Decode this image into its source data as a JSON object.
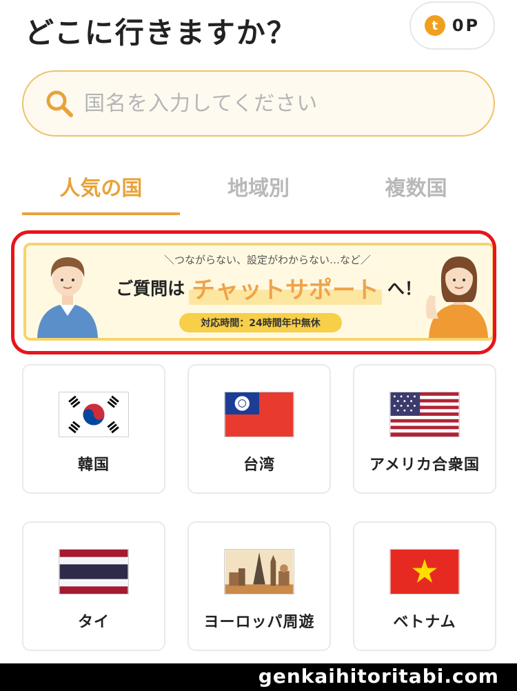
{
  "header": {
    "title": "どこに行きますか？",
    "points": "0P",
    "points_icon_letter": "t"
  },
  "search": {
    "placeholder": "国名を入力してください"
  },
  "tabs": [
    {
      "label": "人気の国",
      "active": true
    },
    {
      "label": "地域別",
      "active": false
    },
    {
      "label": "複数国",
      "active": false
    }
  ],
  "banner": {
    "subtext": "＼つながらない、設定がわからない…など／",
    "prefix": "ご質問は",
    "highlight": "チャットサポート",
    "suffix": "へ！",
    "hours": "対応時間：24時間年中無休"
  },
  "countries": [
    {
      "name": "韓国",
      "flag": "south-korea-flag"
    },
    {
      "name": "台湾",
      "flag": "taiwan-flag"
    },
    {
      "name": "アメリカ合衆国",
      "flag": "usa-flag"
    },
    {
      "name": "タイ",
      "flag": "thailand-flag"
    },
    {
      "name": "ヨーロッパ周遊",
      "flag": "europe-landmarks-image"
    },
    {
      "name": "ベトナム",
      "flag": "vietnam-flag"
    }
  ],
  "watermark": "genkaihitoritabi.com",
  "colors": {
    "accent": "#e7a33b",
    "annotation": "#e8141a",
    "banner_yellow": "#f6d46b"
  }
}
